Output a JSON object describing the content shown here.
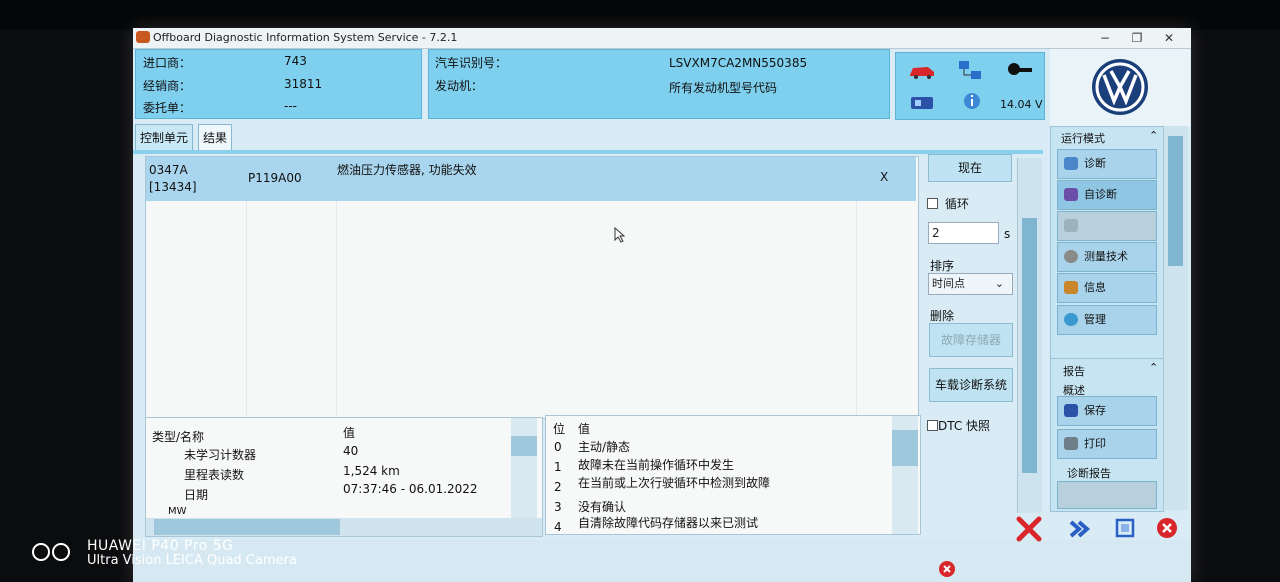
{
  "window": {
    "title": "Offboard Diagnostic Information System Service - 7.2.1",
    "minimize": "−",
    "restore": "❐",
    "close": "✕"
  },
  "header": {
    "importer_label": "进口商：",
    "importer_value": "743",
    "dealer_label": "经销商：",
    "dealer_value": "31811",
    "order_label": "委托单：",
    "order_value": "---",
    "vin_label": "汽车识别号：",
    "vin_value": "LSVXM7CA2MN550385",
    "engine_label": "发动机：",
    "engine_value": "所有发动机型号代码",
    "voltage": "14.04 V",
    "icons": [
      "car-icon",
      "network-icon",
      "key-icon",
      "usb-icon",
      "info-icon"
    ]
  },
  "tabs": [
    "控制单元",
    "结果"
  ],
  "fault": {
    "code_top": "0347A",
    "code_bottom": "[13434]",
    "dtc": "P119A00",
    "description": "燃油压力传感器, 功能失效",
    "close": "X"
  },
  "controls": {
    "current_button": "现在",
    "loop_label": "循环",
    "seconds_value": "2",
    "seconds_unit": "s",
    "sort_label": "排序",
    "sort_value": "时间点",
    "delete_label": "删除",
    "fault_memory_button": "故障存储器",
    "onboard_button": "车载诊断系统",
    "dtc_snapshot_label": "DTC 快照"
  },
  "env_table": {
    "header_type": "类型/名称",
    "header_value": "值",
    "rows": [
      {
        "name": "未学习计数器",
        "value": "40"
      },
      {
        "name": "里程表读数",
        "value": "1,524 km"
      },
      {
        "name": "日期",
        "value": "07:37:46 - 06.01.2022"
      }
    ],
    "partial_row": "MW"
  },
  "status_table": {
    "header_bit": "位",
    "header_value": "值",
    "rows": [
      {
        "bit": "0",
        "value": "主动/静态"
      },
      {
        "bit": "1",
        "value": "故障未在当前操作循环中发生"
      },
      {
        "bit": "2",
        "value": "在当前或上次行驶循环中检测到故障"
      },
      {
        "bit": "3",
        "value": "没有确认"
      },
      {
        "bit": "4",
        "value": "自清除故障代码存储器以来已测试"
      }
    ]
  },
  "sidebar": {
    "mode_header": "运行模式",
    "mode_items": [
      {
        "label": "诊断",
        "icon": "diagnosis-icon",
        "enabled": true
      },
      {
        "label": "自诊断",
        "icon": "self-diagnosis-icon",
        "enabled": true
      },
      {
        "label": "",
        "icon": "disabled-mode-icon",
        "enabled": false
      },
      {
        "label": "测量技术",
        "icon": "measurement-icon",
        "enabled": true
      },
      {
        "label": "信息",
        "icon": "info-book-icon",
        "enabled": true
      },
      {
        "label": "管理",
        "icon": "admin-icon",
        "enabled": true
      }
    ],
    "report_header": "报告",
    "overview_label": "概述",
    "report_items": [
      {
        "label": "保存",
        "icon": "save-icon"
      },
      {
        "label": "打印",
        "icon": "print-icon"
      }
    ],
    "diag_report_label": "诊断报告"
  },
  "watermark": {
    "line1": "HUAWEI P40 Pro 5G",
    "line2": "Ultra Vision LEICA Quad Camera"
  },
  "colors": {
    "header_bg": "#7fd0ee",
    "selected_row": "#a9d6ee",
    "cancel_red": "#d8262a"
  }
}
